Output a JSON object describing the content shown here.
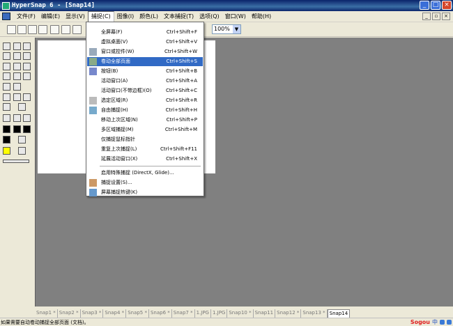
{
  "title": "HyperSnap 6 - [Snap14]",
  "menubar": [
    "文件(F)",
    "编辑(E)",
    "显示(V)",
    "捕捉(C)",
    "图像(I)",
    "颜色(L)",
    "文本捕捉(T)",
    "选项(Q)",
    "窗口(W)",
    "帮助(H)"
  ],
  "zoom": "100%",
  "capture_menu": {
    "items": [
      {
        "label": "全屏幕(F)",
        "shortcut": "Ctrl+Shift+F"
      },
      {
        "label": "虚拟桌面(V)",
        "shortcut": "Ctrl+Shift+V"
      },
      {
        "label": "窗口或控件(W)",
        "shortcut": "Ctrl+Shift+W"
      },
      {
        "label": "卷动全部页面",
        "shortcut": "Ctrl+Shift+S"
      },
      {
        "label": "按钮(B)",
        "shortcut": "Ctrl+Shift+B"
      },
      {
        "label": "活动窗口(A)",
        "shortcut": "Ctrl+Shift+A"
      },
      {
        "label": "活动窗口(不带边框)(O)",
        "shortcut": "Ctrl+Shift+C"
      },
      {
        "label": "选定区域(R)",
        "shortcut": "Ctrl+Shift+R"
      },
      {
        "label": "自由捕捉(H)",
        "shortcut": "Ctrl+Shift+H"
      },
      {
        "label": "移动上次区域(N)",
        "shortcut": "Ctrl+Shift+P"
      },
      {
        "label": "多区域捕捉(M)",
        "shortcut": "Ctrl+Shift+M"
      },
      {
        "label": "仅捕捉鼠标指针",
        "shortcut": ""
      },
      {
        "label": "重复上次捕捉(L)",
        "shortcut": "Ctrl+Shift+F11"
      },
      {
        "label": "延展活动窗口(X)",
        "shortcut": "Ctrl+Shift+X"
      }
    ],
    "extra": [
      "启用特殊捕捉 (DirectX, Glide)...",
      "捕捉设置(S)...",
      "屏幕捕捉热键(K)"
    ]
  },
  "tabs": [
    "Snap1 *",
    "Snap2 *",
    "Snap3 *",
    "Snap4 *",
    "Snap5 *",
    "Snap6 *",
    "Snap7 *",
    "1.JPG",
    "1.JPG",
    "Snap10 *",
    "Snap11",
    "Snap12 *",
    "Snap13 *",
    "Snap14"
  ],
  "status": "如果需要自动卷动捕捉全部页面 (文档)。",
  "tray": {
    "brand": "Sogou",
    "lang": "中"
  }
}
